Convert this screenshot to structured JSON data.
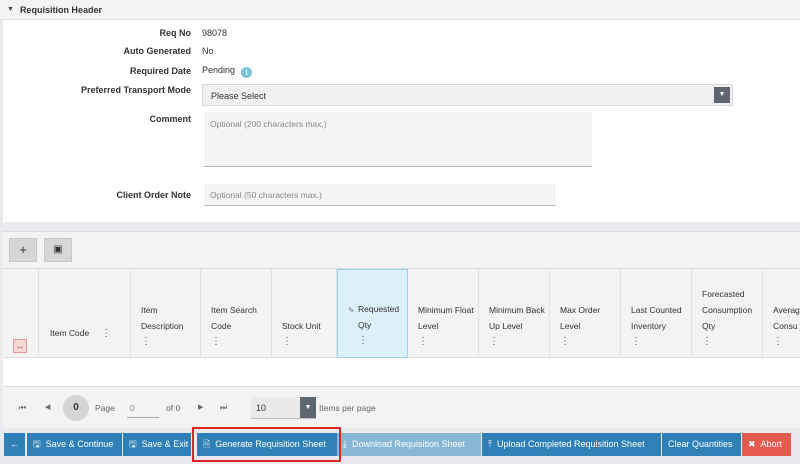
{
  "section": {
    "title": "Requisition Header"
  },
  "form": {
    "req_no_label": "Req No",
    "req_no_value": "98078",
    "auto_generated_label": "Auto Generated",
    "auto_generated_value": "No",
    "required_date_label": "Required Date",
    "required_date_value": "Pending",
    "transport_label": "Preferred Transport Mode",
    "transport_value": "Please Select",
    "comment_label": "Comment",
    "comment_placeholder": "Optional (200 characters max.)",
    "client_note_label": "Client Order Note",
    "client_note_placeholder": "Optional (50 characters max.)"
  },
  "toolbar": {
    "add_symbol": "+",
    "excel_symbol": "▣"
  },
  "grid": {
    "columns": [
      {
        "line1": "",
        "line2": "",
        "line3": "Item Code"
      },
      {
        "line1": "",
        "line2": "Item",
        "line3": "Description"
      },
      {
        "line1": "",
        "line2": "Item Search",
        "line3": "Code"
      },
      {
        "line1": "",
        "line2": "",
        "line3": "Stock Unit"
      },
      {
        "line1": "",
        "line2": "Requested",
        "line3": "Qty"
      },
      {
        "line1": "",
        "line2": "Minimum Float",
        "line3": "Level"
      },
      {
        "line1": "",
        "line2": "Minimum Back",
        "line3": "Up Level"
      },
      {
        "line1": "",
        "line2": "Max Order",
        "line3": "Level"
      },
      {
        "line1": "",
        "line2": "Last Counted",
        "line3": "Inventory"
      },
      {
        "line1": "Forecasted",
        "line2": "Consumption",
        "line3": "Qty"
      },
      {
        "line1": "",
        "line2": "Averag",
        "line3": "Consu"
      }
    ],
    "dots": "⋮"
  },
  "pager": {
    "first": "⏮",
    "prev": "◀",
    "current_page": "0",
    "page_label": "Page",
    "page_input": "0",
    "of_label": "of 0",
    "next": "▶",
    "last": "⏭",
    "page_size": "10",
    "items_per_page": "Items per page"
  },
  "actions": {
    "back": "←",
    "save_continue": "Save & Continue",
    "save_exit": "Save & Exit",
    "generate": "Generate Requisition Sheet",
    "download": "Download Requisition Sheet",
    "upload": "Upload Completed Requisition Sheet",
    "clear": "Clear Quantities",
    "abort": "Abort"
  },
  "colors": {
    "primary": "#2f80b6",
    "disabled": "#86b8d6",
    "danger": "#e55a4f",
    "highlight": "#e02525"
  }
}
